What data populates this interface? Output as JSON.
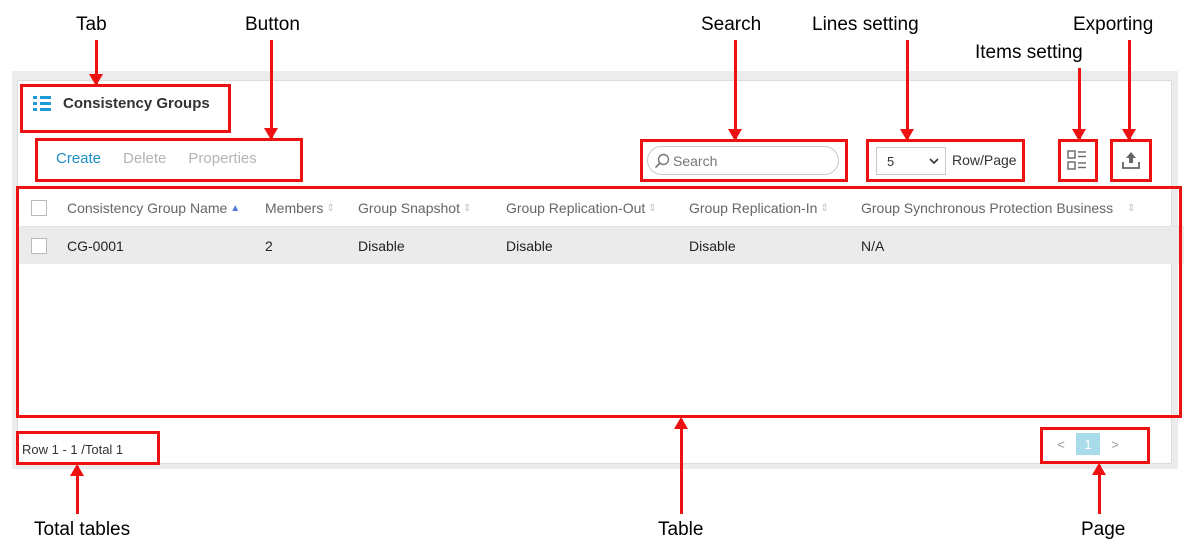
{
  "annotations": {
    "tab": "Tab",
    "button": "Button",
    "search": "Search",
    "lines_setting": "Lines setting",
    "items_setting": "Items setting",
    "exporting": "Exporting",
    "total_tables": "Total tables",
    "table": "Table",
    "page": "Page"
  },
  "tab": {
    "title": "Consistency Groups",
    "icon": "list-icon"
  },
  "toolbar": {
    "create": "Create",
    "delete": "Delete",
    "properties": "Properties"
  },
  "search": {
    "placeholder": "Search",
    "icon": "search-icon"
  },
  "rows_per_page": {
    "value": "5",
    "label": "Row/Page"
  },
  "icons": {
    "items_setting": "column-settings-icon",
    "export": "export-icon"
  },
  "table": {
    "columns": [
      "Consistency Group Name",
      "Members",
      "Group Snapshot",
      "Group Replication-Out",
      "Group Replication-In",
      "Group Synchronous Protection Business"
    ],
    "rows": [
      [
        "CG-0001",
        "2",
        "Disable",
        "Disable",
        "Disable",
        "N/A"
      ]
    ]
  },
  "footer": {
    "summary": "Row 1 - 1 /Total 1"
  },
  "pagination": {
    "prev": "<",
    "current": "1",
    "next": ">"
  },
  "colors": {
    "accent": "#1e8fc6",
    "annotation": "#ee1111",
    "page_active": "#a9dcea"
  }
}
